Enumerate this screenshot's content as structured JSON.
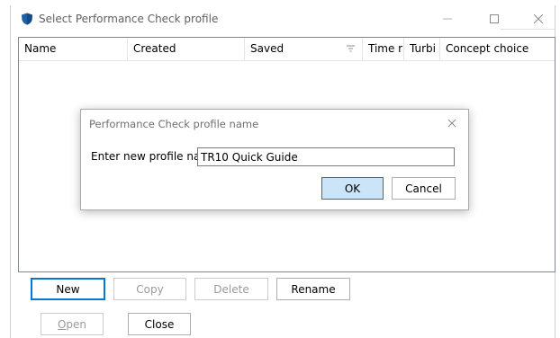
{
  "window": {
    "title": "Select Performance Check profile",
    "icon": "shield-icon",
    "controls": [
      "minimize-icon",
      "maximize-icon",
      "close-icon"
    ]
  },
  "list": {
    "columns": [
      {
        "label": "Name"
      },
      {
        "label": "Created"
      },
      {
        "label": "Saved",
        "sort_icon": "sort-descending-icon"
      },
      {
        "label": "Time r"
      },
      {
        "label": "Turbi"
      },
      {
        "label": "Concept choice"
      }
    ],
    "rows": []
  },
  "buttons": {
    "new": "New",
    "copy": "Copy",
    "delete": "Delete",
    "rename": "Rename",
    "open": "Open",
    "close": "Close"
  },
  "dialog": {
    "title": "Performance Check profile name",
    "label": "Enter new profile name",
    "input_value": "TR10 Quick Guide",
    "ok": "OK",
    "cancel": "Cancel"
  },
  "colors": {
    "accent": "#0078d7",
    "ok_fill": "#cce4f7",
    "icon_blue": "#1f5fa8"
  }
}
